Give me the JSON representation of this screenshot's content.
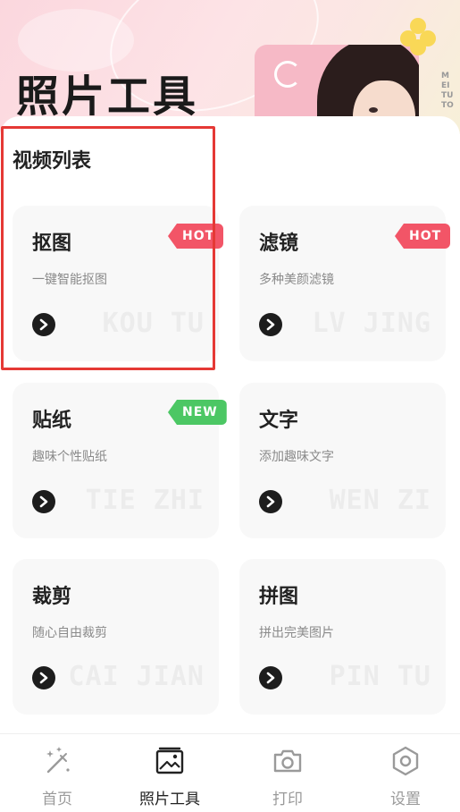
{
  "header": {
    "title": "照片工具",
    "brand_vertical": "MEITU TO"
  },
  "section": {
    "title": "视频列表"
  },
  "tools": [
    {
      "name": "抠图",
      "desc": "一键智能抠图",
      "watermark": "KOU TU",
      "badge": "HOT"
    },
    {
      "name": "滤镜",
      "desc": "多种美颜滤镜",
      "watermark": "LV JING",
      "badge": "HOT"
    },
    {
      "name": "贴纸",
      "desc": "趣味个性贴纸",
      "watermark": "TIE ZHI",
      "badge": "NEW"
    },
    {
      "name": "文字",
      "desc": "添加趣味文字",
      "watermark": "WEN ZI",
      "badge": ""
    },
    {
      "name": "裁剪",
      "desc": "随心自由裁剪",
      "watermark": "CAI JIAN",
      "badge": ""
    },
    {
      "name": "拼图",
      "desc": "拼出完美图片",
      "watermark": "PIN TU",
      "badge": ""
    }
  ],
  "tabbar": {
    "items": [
      {
        "label": "首页",
        "icon": "magic-wand-icon"
      },
      {
        "label": "照片工具",
        "icon": "photo-icon",
        "active": true
      },
      {
        "label": "打印",
        "icon": "camera-icon"
      },
      {
        "label": "设置",
        "icon": "hexagon-settings-icon"
      }
    ]
  },
  "colors": {
    "hot_badge": "#f25567",
    "new_badge": "#4cc764",
    "highlight_border": "#e53935",
    "card_bg": "#f8f8f8"
  }
}
